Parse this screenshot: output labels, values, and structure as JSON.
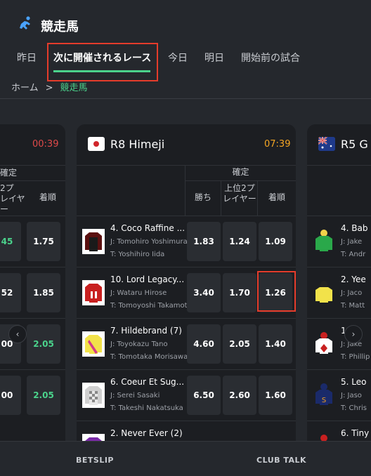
{
  "header": {
    "title": "競走馬",
    "icon": "horse-racing-icon"
  },
  "tabs": [
    {
      "label": "昨日"
    },
    {
      "label": "次に開催されるレース"
    },
    {
      "label": "今日"
    },
    {
      "label": "明日"
    },
    {
      "label": "開始前の試合"
    }
  ],
  "breadcrumb": {
    "home": "ホーム",
    "sep": ">",
    "current": "競走馬"
  },
  "colors": {
    "accent": "#4bd38c",
    "highlight": "#e53c2b",
    "time_red": "#e04a4a",
    "time_orange": "#f5a623"
  },
  "left_card": {
    "time": "00:39",
    "group_header": "確定",
    "col_place": "上位2プレイヤー",
    "col_place_visible": "2プ\nレイヤ\nー",
    "col_show": "着順",
    "rows": [
      {
        "place": "45",
        "show": "1.75"
      },
      {
        "place": "52",
        "show": "1.85"
      },
      {
        "place": "00",
        "show": "2.05"
      },
      {
        "place": "00",
        "show": "2.05"
      }
    ]
  },
  "main_card": {
    "race": "R8 Himeji",
    "flag": "japan-flag-icon",
    "time": "07:39",
    "group_header": "確定",
    "col_win": "勝ち",
    "col_place": "上位2プレイヤー",
    "col_show": "着順",
    "rows": [
      {
        "horse": "4. Coco Raffine ...",
        "jockey": "J: Tomohiro Yoshimura",
        "trainer": "T: Yoshihiro Iida",
        "win": "1.83",
        "place": "1.24",
        "show": "1.09"
      },
      {
        "horse": "10. Lord Legacy...",
        "jockey": "J: Wataru Hirose",
        "trainer": "T: Tomoyoshi Takamoto",
        "win": "3.40",
        "place": "1.70",
        "show": "1.26"
      },
      {
        "horse": "7. Hildebrand (7)",
        "jockey": "J: Toyokazu Tano",
        "trainer": "T: Tomotaka Morisawa",
        "win": "4.60",
        "place": "2.05",
        "show": "1.40"
      },
      {
        "horse": "6. Coeur Et Sug...",
        "jockey": "J: Serei Sasaki",
        "trainer": "T: Takeshi Nakatsuka",
        "win": "6.50",
        "place": "2.60",
        "show": "1.60"
      },
      {
        "horse": "2. Never Ever (2)",
        "jockey": "",
        "trainer": "",
        "win": "",
        "place": "",
        "show": ""
      }
    ]
  },
  "right_card": {
    "race": "R5 G",
    "flag": "australia-flag-icon",
    "rows": [
      {
        "horse": "4. Bab",
        "jockey": "J: Jake",
        "trainer": "T: Andr"
      },
      {
        "horse": "2. Yee",
        "jockey": "J: Jaco",
        "trainer": "T: Matt"
      },
      {
        "horse": "1. M",
        "jockey": "J: Jake",
        "trainer": "T: Phillip"
      },
      {
        "horse": "5. Leo",
        "jockey": "J: Jaso",
        "trainer": "T: Chris"
      },
      {
        "horse": "6. Tiny",
        "jockey": "",
        "trainer": ""
      }
    ]
  },
  "bottom": {
    "betslip": "BETSLIP",
    "club_talk": "CLUB TALK"
  }
}
